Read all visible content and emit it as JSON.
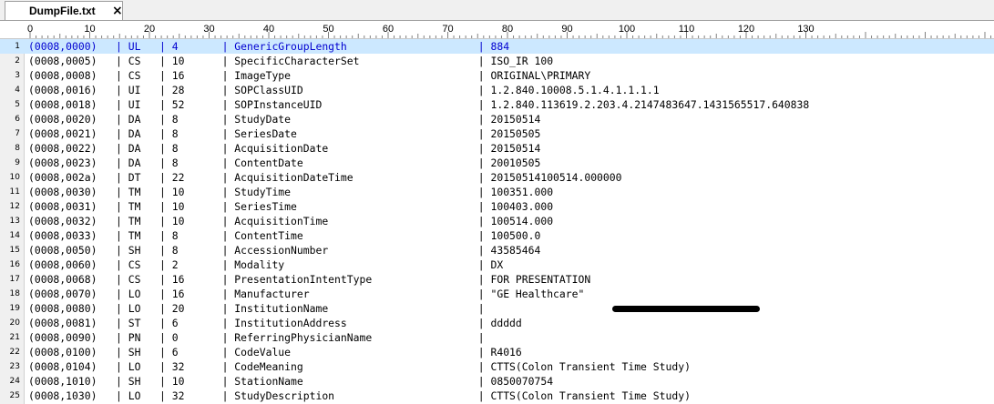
{
  "tab": {
    "title": "DumpFile.txt",
    "close_glyph": "×"
  },
  "ruler": {
    "labels": [
      "0",
      "10",
      "20",
      "30",
      "40",
      "50",
      "60",
      "70",
      "80",
      "90",
      "100",
      "110",
      "120",
      "130"
    ]
  },
  "lines": [
    {
      "n": "1",
      "text": "(0008,0000)   | UL   | 4       | GenericGroupLength                     | 884"
    },
    {
      "n": "2",
      "text": "(0008,0005)   | CS   | 10      | SpecificCharacterSet                   | ISO_IR 100"
    },
    {
      "n": "3",
      "text": "(0008,0008)   | CS   | 16      | ImageType                              | ORIGINAL\\PRIMARY"
    },
    {
      "n": "4",
      "text": "(0008,0016)   | UI   | 28      | SOPClassUID                            | 1.2.840.10008.5.1.4.1.1.1.1"
    },
    {
      "n": "5",
      "text": "(0008,0018)   | UI   | 52      | SOPInstanceUID                         | 1.2.840.113619.2.203.4.2147483647.1431565517.640838"
    },
    {
      "n": "6",
      "text": "(0008,0020)   | DA   | 8       | StudyDate                              | 20150514"
    },
    {
      "n": "7",
      "text": "(0008,0021)   | DA   | 8       | SeriesDate                             | 20150505"
    },
    {
      "n": "8",
      "text": "(0008,0022)   | DA   | 8       | AcquisitionDate                        | 20150514"
    },
    {
      "n": "9",
      "text": "(0008,0023)   | DA   | 8       | ContentDate                            | 20010505"
    },
    {
      "n": "10",
      "text": "(0008,002a)   | DT   | 22      | AcquisitionDateTime                    | 20150514100514.000000"
    },
    {
      "n": "11",
      "text": "(0008,0030)   | TM   | 10      | StudyTime                              | 100351.000"
    },
    {
      "n": "12",
      "text": "(0008,0031)   | TM   | 10      | SeriesTime                             | 100403.000"
    },
    {
      "n": "13",
      "text": "(0008,0032)   | TM   | 10      | AcquisitionTime                        | 100514.000"
    },
    {
      "n": "14",
      "text": "(0008,0033)   | TM   | 8       | ContentTime                            | 100500.0"
    },
    {
      "n": "15",
      "text": "(0008,0050)   | SH   | 8       | AccessionNumber                        | 43585464"
    },
    {
      "n": "16",
      "text": "(0008,0060)   | CS   | 2       | Modality                               | DX"
    },
    {
      "n": "17",
      "text": "(0008,0068)   | CS   | 16      | PresentationIntentType                 | FOR PRESENTATION"
    },
    {
      "n": "18",
      "text": "(0008,0070)   | LO   | 16      | Manufacturer                           | \"GE Healthcare\""
    },
    {
      "n": "19",
      "text": "(0008,0080)   | LO   | 20      | InstitutionName                        |"
    },
    {
      "n": "20",
      "text": "(0008,0081)   | ST   | 6       | InstitutionAddress                     | ddddd"
    },
    {
      "n": "21",
      "text": "(0008,0090)   | PN   | 0       | ReferringPhysicianName                 |"
    },
    {
      "n": "22",
      "text": "(0008,0100)   | SH   | 6       | CodeValue                              | R4016"
    },
    {
      "n": "23",
      "text": "(0008,0104)   | LO   | 32      | CodeMeaning                            | CTTS(Colon Transient Time Study)"
    },
    {
      "n": "24",
      "text": "(0008,1010)   | SH   | 10      | StationName                            | 0850070754"
    },
    {
      "n": "25",
      "text": "(0008,1030)   | LO   | 32      | StudyDescription                       | CTTS(Colon Transient Time Study)"
    }
  ]
}
